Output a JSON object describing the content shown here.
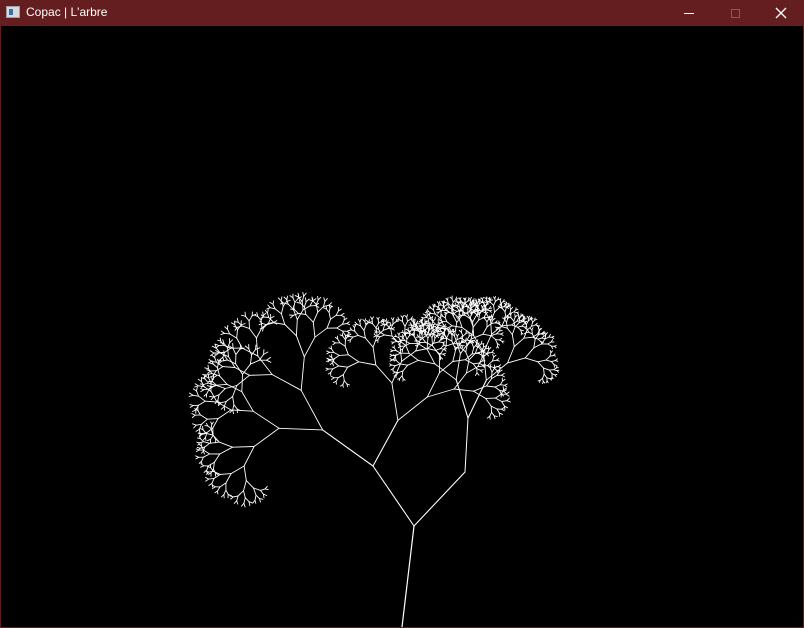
{
  "window": {
    "title": "Copac | L'arbre",
    "app_icon": "window-app-icon",
    "controls": {
      "minimize_icon": "minimize-icon",
      "maximize_icon": "maximize-icon",
      "close_icon": "close-icon"
    },
    "colors": {
      "titlebar": "#651e1f",
      "canvas_background": "#000000",
      "tree_color": "#ffffff",
      "disabled_control": "#8b5a5a"
    }
  },
  "canvas": {
    "content": "fractal-tree",
    "branch_depth": 11
  }
}
